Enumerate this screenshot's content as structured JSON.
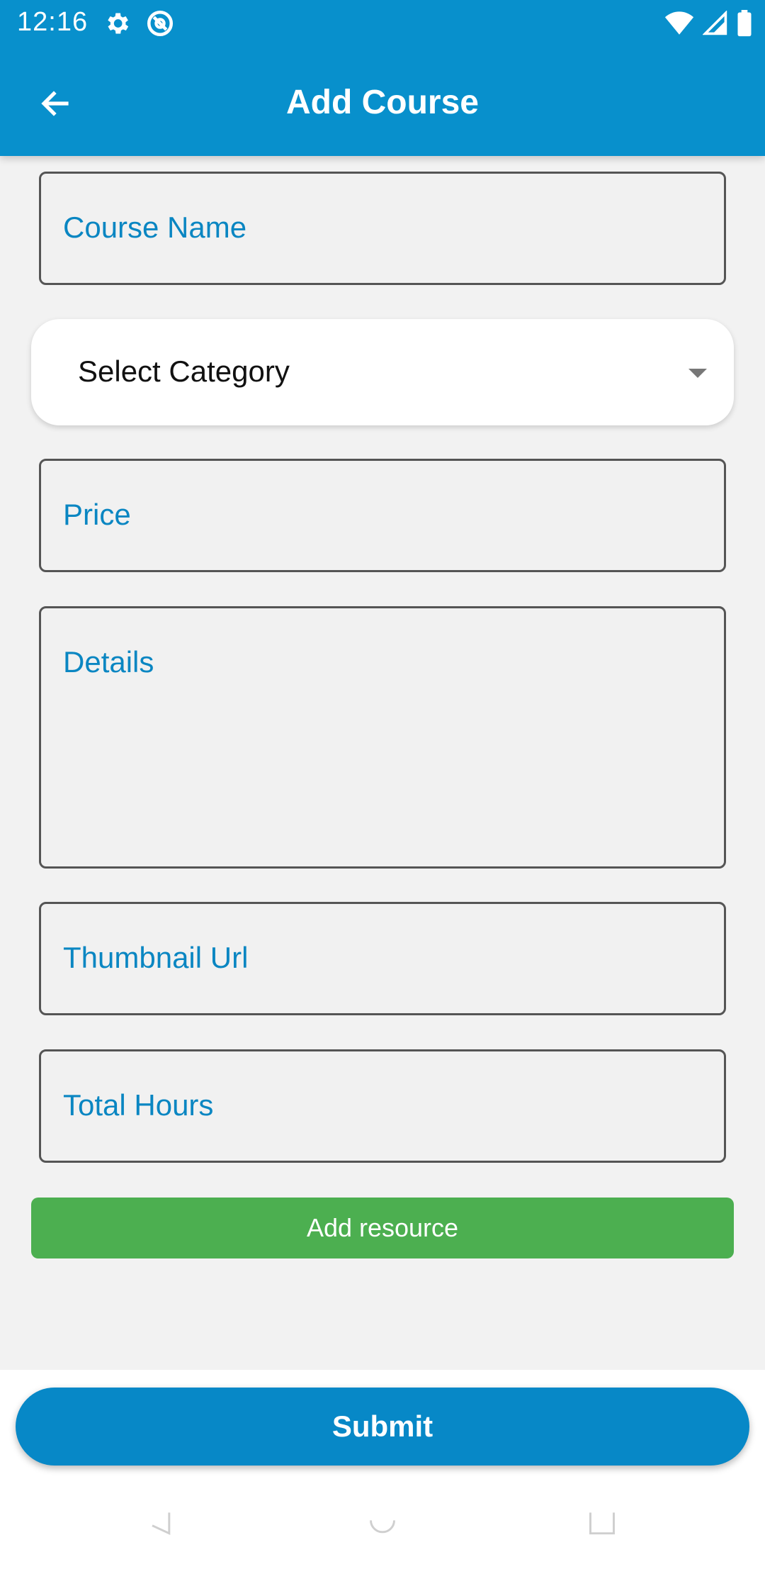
{
  "status_bar": {
    "time": "12:16",
    "icons_left": [
      "gear-icon",
      "at-sign-icon"
    ],
    "icons_right": [
      "wifi-icon",
      "cell-signal-icon",
      "battery-icon"
    ]
  },
  "app_bar": {
    "title": "Add Course",
    "back_icon": "arrow-left-icon",
    "background": "#0890cc"
  },
  "form": {
    "course_name_placeholder": "Course Name",
    "category_select": {
      "value": "Select Category",
      "icon": "dropdown-caret-icon"
    },
    "price_placeholder": "Price",
    "details_placeholder": "Details",
    "thumbnail_placeholder": "Thumbnail Url",
    "total_hours_placeholder": "Total Hours",
    "add_resource_label": "Add resource"
  },
  "footer": {
    "submit_label": "Submit"
  },
  "colors": {
    "primary": "#0890cc",
    "label": "#0a86c2",
    "add_resource": "#4caf50",
    "page_background": "#f2f2f2"
  },
  "system_nav": [
    "nav-back-icon",
    "nav-home-icon",
    "nav-recents-icon"
  ]
}
